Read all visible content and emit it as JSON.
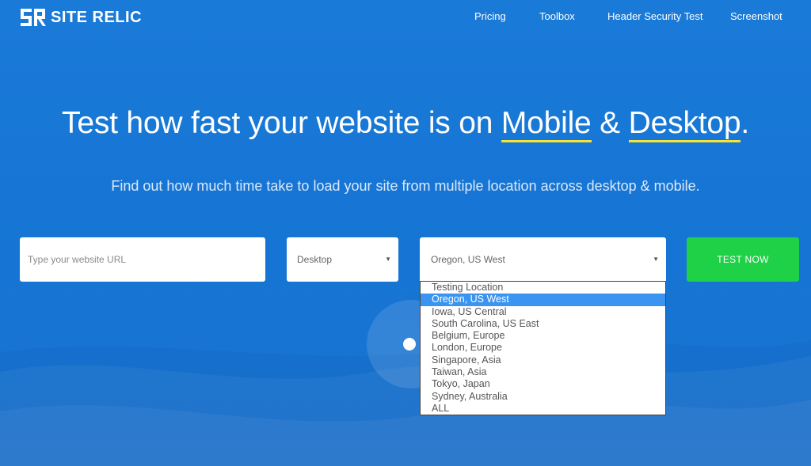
{
  "brand": {
    "name": "SITE RELIC"
  },
  "nav": {
    "items": [
      "Pricing",
      "Toolbox",
      "Header Security Test",
      "Screenshot"
    ]
  },
  "hero": {
    "title_prefix": "Test how fast your website is on ",
    "title_mobile": "Mobile",
    "title_amp": " & ",
    "title_desktop": "Desktop",
    "title_suffix": ".",
    "subtitle": "Find out how much time take to load your site from multiple location across desktop & mobile."
  },
  "form": {
    "url_placeholder": "Type your website URL",
    "device_selected": "Desktop",
    "location_selected": "Oregon, US West",
    "test_button": "TEST NOW",
    "location_options": [
      "Testing Location",
      "Oregon, US West",
      "Iowa, US Central",
      "South Carolina, US East",
      "Belgium, Europe",
      "London, Europe",
      "Singapore, Asia",
      "Taiwan, Asia",
      "Tokyo, Japan",
      "Sydney, Australia",
      "ALL"
    ],
    "location_selected_index": 1
  },
  "colors": {
    "background": "#1675d4",
    "button": "#1ed147",
    "underline": "#f7e434",
    "selected_option": "#3b95f0"
  },
  "icons": {
    "logo": "site-relic-logo-icon",
    "caret": "caret-down-icon"
  }
}
